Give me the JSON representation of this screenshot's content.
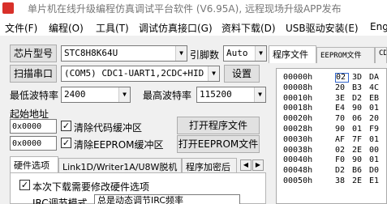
{
  "window": {
    "title": "单片机在线升级编程仿真调试平台软件 (V6.95A), 远程现场升级APP发布"
  },
  "menu": [
    "文件(F)",
    "编程(O)",
    "工具(T)",
    "调试仿真接口(G)",
    "资料下载(D)",
    "USB驱动安装(E)",
    "Eng"
  ],
  "chip": {
    "label": "芯片型号",
    "value": "STC8H8K64U"
  },
  "pins": {
    "label": "引脚数",
    "value": "Auto"
  },
  "port": {
    "scan_label": "扫描串口",
    "value": "(COM5) CDC1-UART1,2CDC+HID",
    "settings_label": "设置"
  },
  "baud": {
    "min_label": "最低波特率",
    "min_value": "2400",
    "max_label": "最高波特率",
    "max_value": "115200"
  },
  "start_address": {
    "label": "起始地址",
    "code_addr": "0x0000",
    "code_clear_label": "清除代码缓冲区",
    "eeprom_addr": "0x0000",
    "eeprom_clear_label": "清除EEPROM缓冲区",
    "open_program_label": "打开程序文件",
    "open_eeprom_label": "打开EEPROM文件"
  },
  "left_tabs": [
    "硬件选项",
    "Link1D/Writer1A/U8W脱机",
    "程序加密后"
  ],
  "options": {
    "modify_hw_label": "本次下载需要修改硬件选项",
    "irc_label": "IRC调节模式",
    "irc_value": "总是动态调节IRC频率"
  },
  "right_tabs": [
    "程序文件",
    "EEPROM文件",
    "CD"
  ],
  "hex": {
    "rows": [
      {
        "addr": "00000h",
        "bytes": [
          "02",
          "3D",
          "DA"
        ]
      },
      {
        "addr": "00008h",
        "bytes": [
          "20",
          "B3",
          "4C"
        ]
      },
      {
        "addr": "00010h",
        "bytes": [
          "3E",
          "D2",
          "EB"
        ]
      },
      {
        "addr": "00018h",
        "bytes": [
          "E4",
          "90",
          "01"
        ]
      },
      {
        "addr": "00020h",
        "bytes": [
          "70",
          "06",
          "20"
        ]
      },
      {
        "addr": "00028h",
        "bytes": [
          "90",
          "01",
          "F9"
        ]
      },
      {
        "addr": "00030h",
        "bytes": [
          "AF",
          "7F",
          "01"
        ]
      },
      {
        "addr": "00038h",
        "bytes": [
          "02",
          "2E",
          "00"
        ]
      },
      {
        "addr": "00040h",
        "bytes": [
          "F0",
          "90",
          "01"
        ]
      },
      {
        "addr": "00048h",
        "bytes": [
          "D2",
          "B6",
          "D0"
        ]
      },
      {
        "addr": "00050h",
        "bytes": [
          "38",
          "2E",
          "E1"
        ]
      }
    ]
  }
}
